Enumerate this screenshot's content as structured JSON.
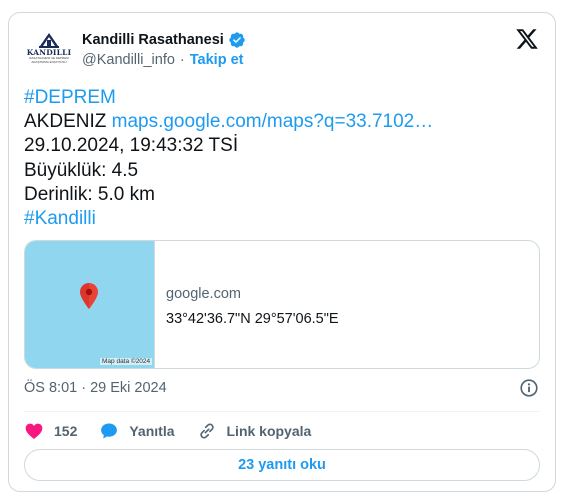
{
  "author": {
    "name": "Kandilli Rasathanesi",
    "handle": "@Kandilli_info",
    "separator": "·",
    "follow_label": "Takip et",
    "logo_text": "KANDILLI",
    "logo_subtext": "RASATHANESI VE DEPREM ARAŞTIRMA ENSTITÜSÜ"
  },
  "tweet": {
    "lines": [
      {
        "hashtag": "#DEPREM"
      },
      {
        "text": "AKDENIZ ",
        "link": "maps.google.com/maps?q=33.7102…"
      },
      {
        "text": "29.10.2024, 19:43:32 TSİ"
      },
      {
        "text": "Büyüklük: 4.5"
      },
      {
        "text": "Derinlik: 5.0 km"
      },
      {
        "hashtag": "#Kandilli"
      }
    ]
  },
  "card": {
    "domain": "google.com",
    "coordinates": "33°42'36.7\"N 29°57'06.5\"E",
    "map_attribution": "Map data ©2024"
  },
  "meta": {
    "timestamp": "ÖS 8:01 · 29 Eki 2024"
  },
  "actions": {
    "like_count": "152",
    "reply_label": "Yanıtla",
    "copy_link_label": "Link kopyala",
    "read_replies_label": "23 yanıtı oku"
  },
  "colors": {
    "accent": "#1d9bf0",
    "like": "#f91880",
    "map_water": "#8fd6ee",
    "pin": "#ea4335"
  },
  "icons": [
    "verified-badge-icon",
    "x-logo-icon",
    "map-pin-icon",
    "info-icon",
    "heart-icon",
    "reply-bubble-icon",
    "link-icon"
  ]
}
